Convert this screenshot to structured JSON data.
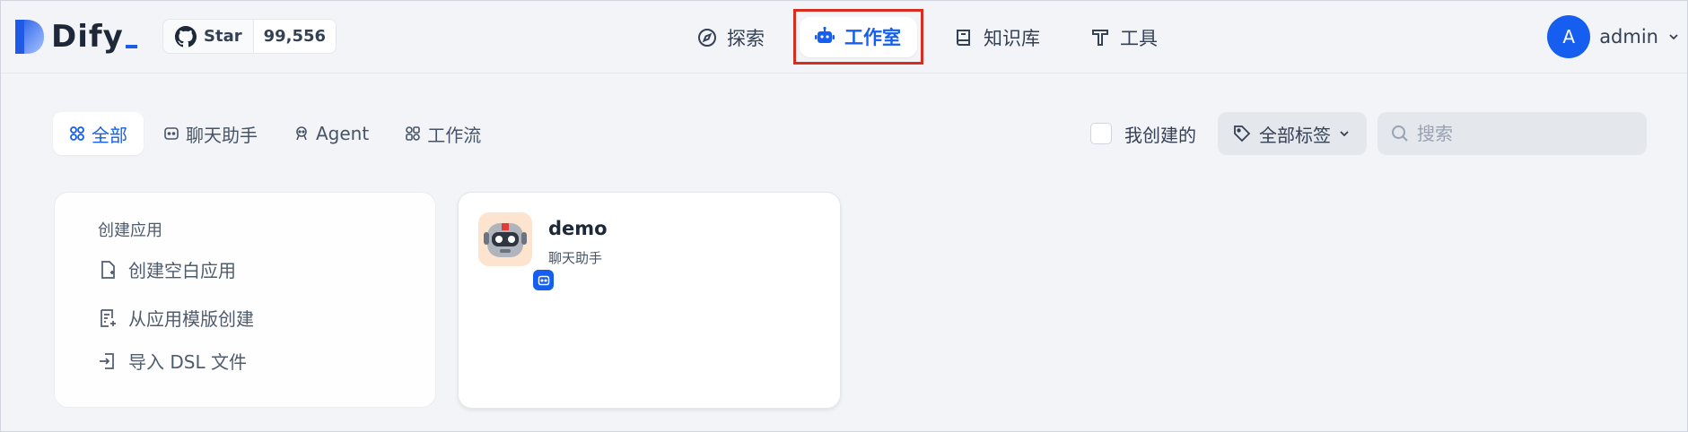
{
  "brand": {
    "name": "Dify",
    "accent": "#155eef"
  },
  "github": {
    "star_label": "Star",
    "star_count": "99,556"
  },
  "nav": {
    "explore": "探索",
    "studio": "工作室",
    "knowledge": "知识库",
    "tools": "工具",
    "active": "studio"
  },
  "user": {
    "avatar_letter": "A",
    "name": "admin"
  },
  "tabs": {
    "all": "全部",
    "chat": "聊天助手",
    "agent": "Agent",
    "workflow": "工作流"
  },
  "filters": {
    "created_by_me": "我创建的",
    "tags": "全部标签",
    "search_placeholder": "搜索"
  },
  "create": {
    "title": "创建应用",
    "blank": "创建空白应用",
    "template": "从应用模版创建",
    "import_dsl": "导入 DSL 文件"
  },
  "apps": [
    {
      "name": "demo",
      "type": "聊天助手",
      "icon": "robot-emoji"
    }
  ]
}
